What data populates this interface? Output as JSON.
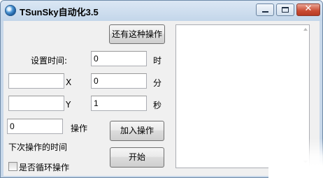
{
  "window": {
    "title": "TSunSky自动化3.5",
    "buttons": {
      "minimize": "minimize",
      "maximize": "maximize",
      "close": "✕"
    }
  },
  "form": {
    "another_action_button": "还有这种操作",
    "set_time_label": "设置时间:",
    "hour": {
      "value": "0",
      "unit": "时"
    },
    "minute": {
      "value": "0",
      "unit": "分"
    },
    "second": {
      "value": "1",
      "unit": "秒"
    },
    "x": {
      "label": "X",
      "value": ""
    },
    "y": {
      "label": "Y",
      "value": ""
    },
    "action": {
      "value": "0",
      "label": "操作"
    },
    "next_action_time_label": "下次操作的时间",
    "add_action_button": "加入操作",
    "start_button": "开始",
    "loop_checkbox_label": "是否循环操作",
    "loop_checked": false
  },
  "log": {
    "text": ""
  }
}
